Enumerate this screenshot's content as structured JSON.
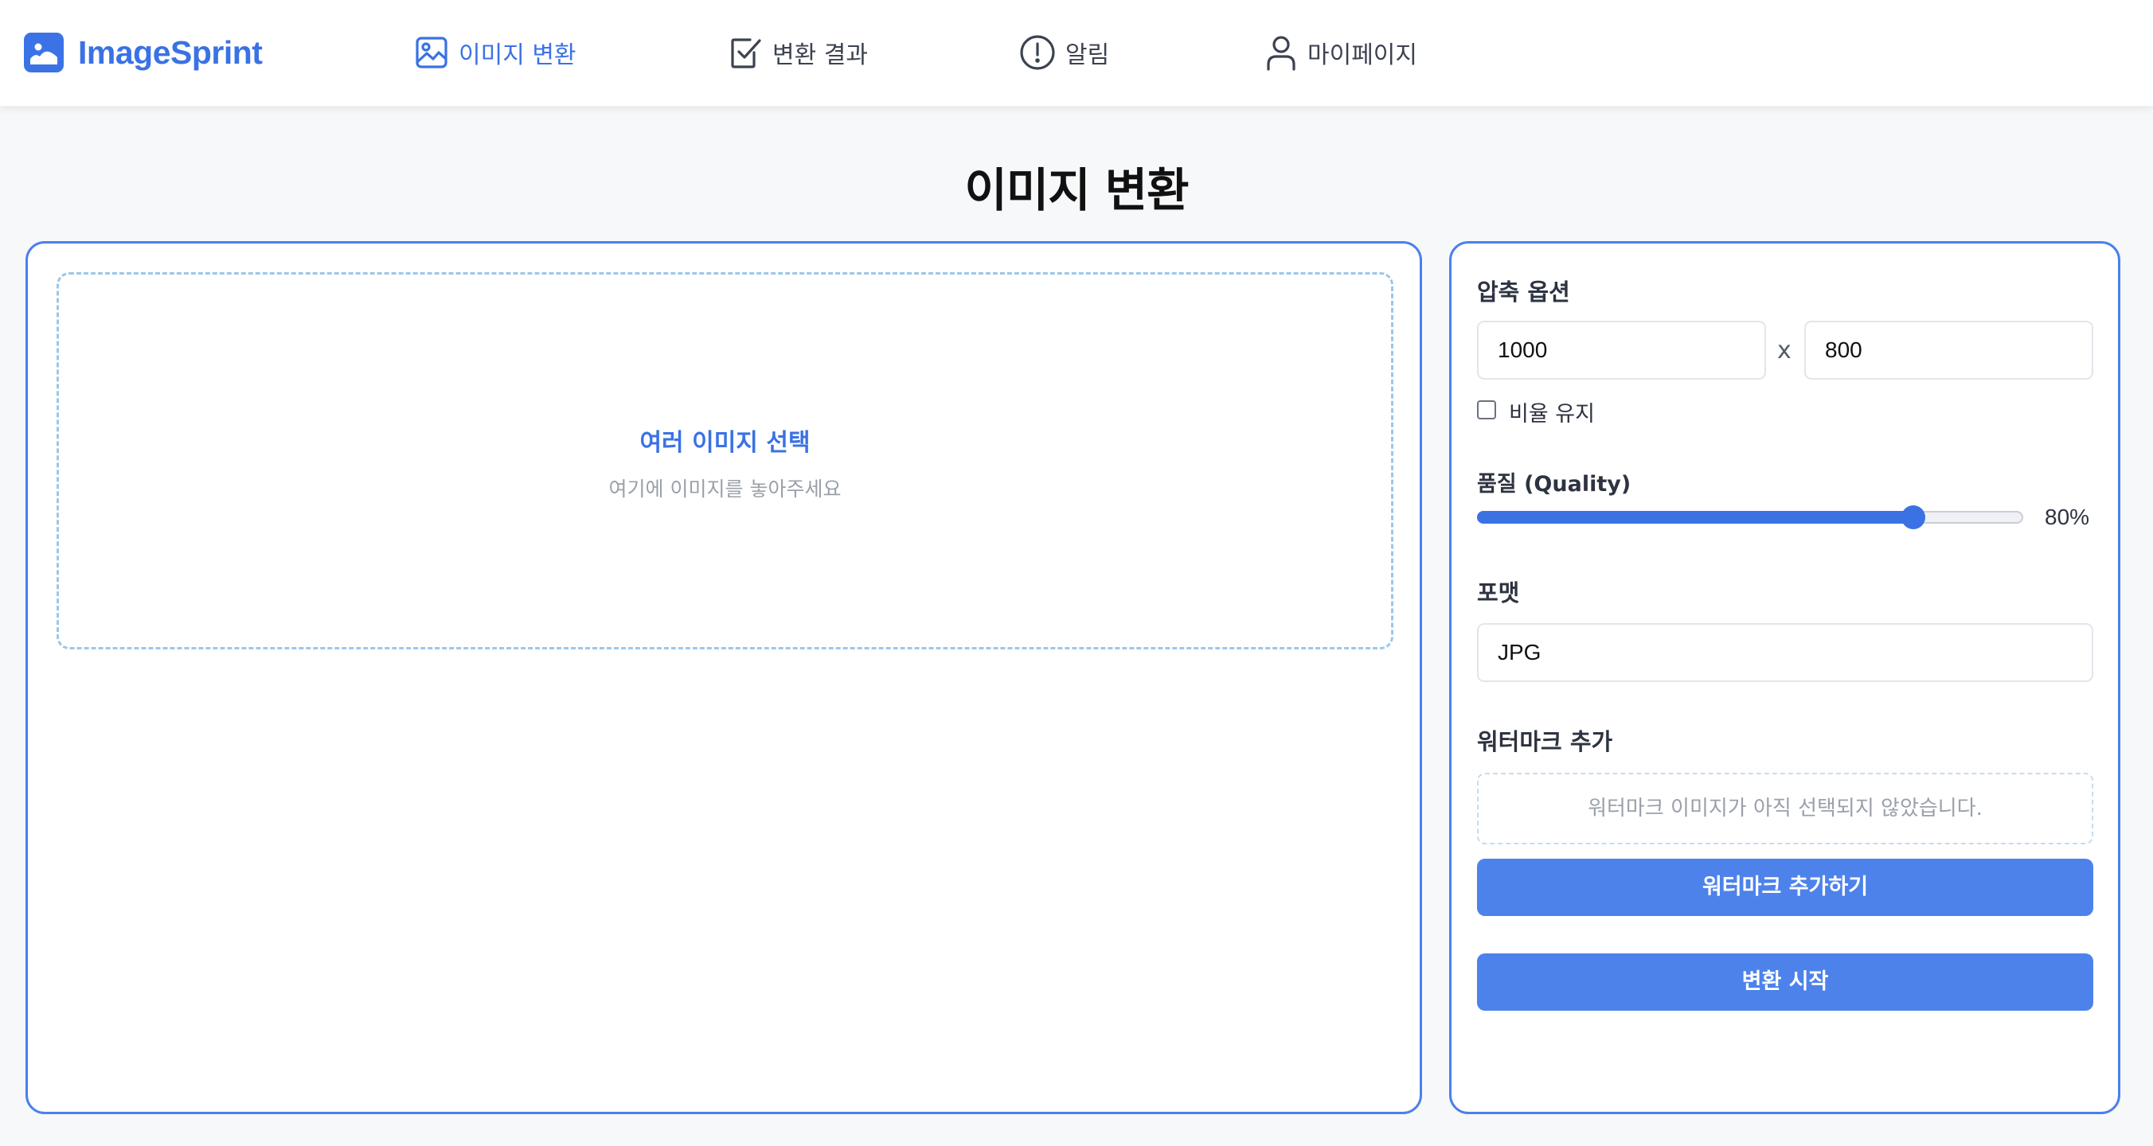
{
  "app": {
    "name": "ImageSprint",
    "logo_icon": "image-icon"
  },
  "nav": [
    {
      "label": "이미지 변환",
      "icon": "image-icon",
      "active": true
    },
    {
      "label": "변환 결과",
      "icon": "check-square-icon",
      "active": false
    },
    {
      "label": "알림",
      "icon": "alert-circle-icon",
      "active": false
    },
    {
      "label": "마이페이지",
      "icon": "user-icon",
      "active": false
    }
  ],
  "page": {
    "title": "이미지 변환"
  },
  "dropzone": {
    "title": "여러 이미지 선택",
    "subtitle": "여기에 이미지를 놓아주세요"
  },
  "compression": {
    "label": "압축 옵션",
    "width": "1000",
    "height": "800",
    "separator": "x",
    "keep_ratio_label": "비율 유지",
    "keep_ratio_checked": false
  },
  "quality": {
    "label": "품질 (Quality)",
    "value": 80,
    "display": "80%"
  },
  "format": {
    "label": "포맷",
    "value": "JPG"
  },
  "watermark": {
    "label": "워터마크 추가",
    "empty_text": "워터마크 이미지가 아직 선택되지 않았습니다.",
    "add_button": "워터마크 추가하기"
  },
  "actions": {
    "start_button": "변환 시작"
  },
  "colors": {
    "accent": "#3a72e4",
    "button": "#4d82eb",
    "panel_border": "#4a80ec",
    "dashed_border": "#9cc7e8",
    "background": "#f7f8fa"
  }
}
